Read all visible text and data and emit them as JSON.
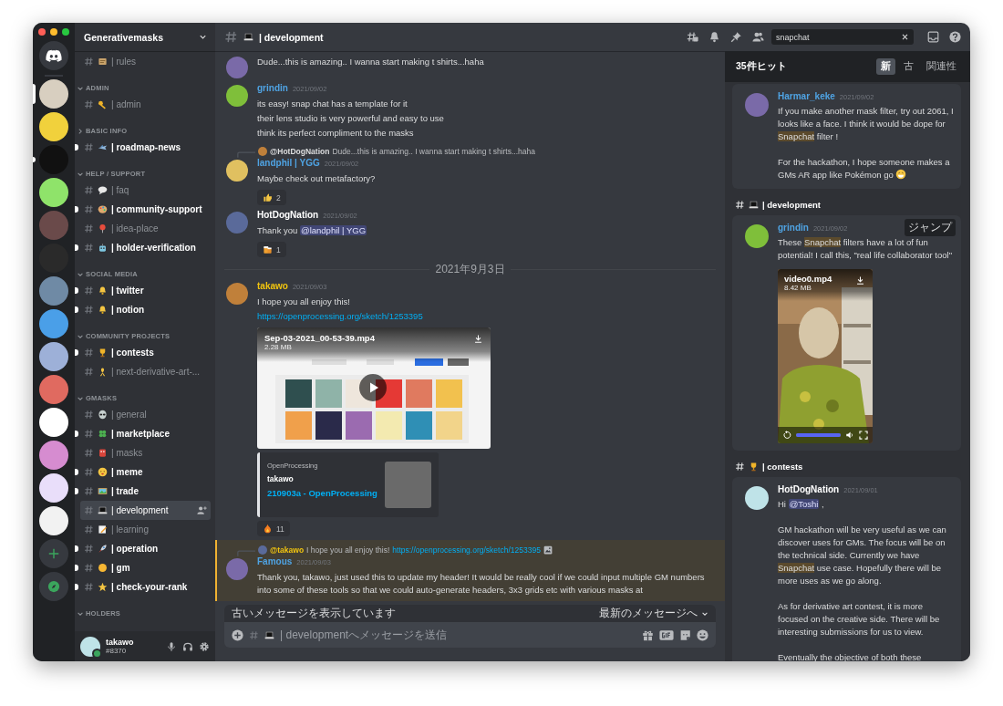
{
  "servers": [
    {
      "selected": true,
      "unread": false
    },
    {
      "selected": false,
      "unread": false
    },
    {
      "selected": false,
      "unread": true
    },
    {
      "selected": false,
      "unread": false
    },
    {
      "selected": false,
      "unread": false
    },
    {
      "selected": false,
      "unread": false
    },
    {
      "selected": false,
      "unread": false
    },
    {
      "selected": false,
      "unread": false
    },
    {
      "selected": false,
      "unread": false
    },
    {
      "selected": false,
      "unread": false
    },
    {
      "selected": false,
      "unread": false
    },
    {
      "selected": false,
      "unread": false
    },
    {
      "selected": false,
      "unread": false
    },
    {
      "selected": false,
      "unread": false
    }
  ],
  "server_name": "Generativemasks",
  "channel_sections": [
    {
      "channels": [
        {
          "name": "| rules",
          "kind": "scroll",
          "unread": false,
          "selected": false
        }
      ]
    },
    {
      "category": "ADMIN",
      "expanded": true,
      "channels": [
        {
          "name": "| admin",
          "kind": "key",
          "unread": false,
          "selected": false
        }
      ]
    },
    {
      "category": "BASIC INFO",
      "expanded": false,
      "channels": [
        {
          "name": "| roadmap-news",
          "kind": "plane",
          "unread": true,
          "selected": false
        }
      ]
    },
    {
      "category": "HELP / SUPPORT",
      "expanded": true,
      "channels": [
        {
          "name": "| faq",
          "kind": "bubble",
          "unread": false,
          "selected": false
        },
        {
          "name": "| community-support",
          "kind": "palette",
          "unread": true,
          "selected": false
        },
        {
          "name": "| idea-place",
          "kind": "pin",
          "unread": false,
          "selected": false
        },
        {
          "name": "| holder-verification",
          "kind": "robot",
          "unread": true,
          "selected": false
        }
      ]
    },
    {
      "category": "SOCIAL MEDIA",
      "expanded": true,
      "channels": [
        {
          "name": "| twitter",
          "kind": "bell",
          "unread": true,
          "selected": false
        },
        {
          "name": "| notion",
          "kind": "bell",
          "unread": true,
          "selected": false
        }
      ]
    },
    {
      "category": "COMMUNITY PROJECTS",
      "expanded": true,
      "channels": [
        {
          "name": "| contests",
          "kind": "trophy",
          "unread": true,
          "selected": false
        },
        {
          "name": "| next-derivative-art-...",
          "kind": "ribbon",
          "unread": false,
          "selected": false
        }
      ]
    },
    {
      "category": "GMASKS",
      "expanded": true,
      "channels": [
        {
          "name": "| general",
          "kind": "alien",
          "unread": false,
          "selected": false
        },
        {
          "name": "| marketplace",
          "kind": "clover",
          "unread": true,
          "selected": false
        },
        {
          "name": "| masks",
          "kind": "mask",
          "unread": false,
          "selected": false
        },
        {
          "name": "| meme",
          "kind": "face",
          "unread": true,
          "selected": false
        },
        {
          "name": "| trade",
          "kind": "picture",
          "unread": true,
          "selected": false
        },
        {
          "name": "| development",
          "kind": "laptop",
          "unread": false,
          "selected": true
        },
        {
          "name": "| learning",
          "kind": "pencil",
          "unread": false,
          "selected": false
        },
        {
          "name": "| operation",
          "kind": "rocket",
          "unread": true,
          "selected": false
        },
        {
          "name": "| gm",
          "kind": "sun",
          "unread": true,
          "selected": false
        },
        {
          "name": "| check-your-rank",
          "kind": "star",
          "unread": true,
          "selected": false
        }
      ]
    },
    {
      "category": "HOLDERS",
      "expanded": true
    }
  ],
  "user": {
    "name": "takawo",
    "tag": "#8370"
  },
  "channel_header": {
    "name": "| development",
    "kind": "laptop"
  },
  "search": {
    "value": "snapchat"
  },
  "messages": [
    {
      "kind": "message",
      "lines": [
        "Dude...this is amazing.. I wanna start making t shirts...haha"
      ]
    },
    {
      "kind": "message",
      "author": {
        "name": "grindin",
        "color": "#4fa3e3"
      },
      "time": "2021/09/02",
      "lines": [
        "its easy! snap chat has a template for it",
        "their lens studio is very powerful and easy to use",
        "think its perfect compliment to the masks"
      ]
    },
    {
      "kind": "message",
      "reply": {
        "author": "@HotDogNation",
        "text": "Dude...this is amazing.. I wanna start making t shirts...haha"
      },
      "author": {
        "name": "landphil | YGG",
        "color": "#4fa3e3"
      },
      "time": "2021/09/02",
      "lines": [
        "Maybe check out metafactory?"
      ],
      "reactions": [
        {
          "kind": "thumbs",
          "count": "2"
        }
      ]
    },
    {
      "kind": "message",
      "author": {
        "name": "HotDogNation",
        "color": "#ffffff"
      },
      "time": "2021/09/02",
      "lines": [
        [
          "Thank you ",
          {
            "text": "@landphil | YGG",
            "kind": "mention"
          }
        ]
      ],
      "reactions": [
        {
          "kind": "beer",
          "count": "1"
        }
      ]
    },
    {
      "kind": "divider",
      "text": "2021年9月3日"
    },
    {
      "kind": "message",
      "author": {
        "name": "takawo",
        "color": "#f1c40f"
      },
      "time": "2021/09/03",
      "lines": [
        "I hope you all enjoy this!",
        {
          "text": "https://openprocessing.org/sketch/1253395",
          "kind": "link"
        }
      ],
      "video": {
        "filename": "Sep-03-2021_00-53-39.mp4",
        "size": "2.28 MB"
      },
      "embed": {
        "provider": "OpenProcessing",
        "author": "takawo",
        "title": "210903a - OpenProcessing"
      },
      "reactions": [
        {
          "kind": "fire",
          "count": "11"
        }
      ]
    },
    {
      "kind": "message",
      "highlighted": true,
      "reply": {
        "author": "@takawo",
        "color": "#f1c40f",
        "text": "I hope you all enjoy this!",
        "link": "https://openprocessing.org/sketch/1253395",
        "image": true
      },
      "author": {
        "name": "Famous",
        "color": "#4fa3e3"
      },
      "time": "2021/09/03",
      "lines": [
        "Thank you, takawo, just used this to update my header! It would be really cool if we could input multiple GM numbers into some of these tools so that we could auto-generate headers, 3x3 grids etc with various masks at"
      ]
    }
  ],
  "notice_bar": {
    "text": "古いメッセージを表示しています",
    "jump_label": "最新のメッセージへ"
  },
  "composer": {
    "kind": "laptop",
    "placeholder": "| developmentへメッセージを送信"
  },
  "search_results": {
    "count": "35件ヒット",
    "sort_tabs": [
      {
        "label": "新",
        "selected": true
      },
      {
        "label": "古",
        "selected": false
      },
      {
        "label": "関連性",
        "selected": false
      }
    ],
    "groups": [
      {
        "results": [
          {
            "author": {
              "name": "Harmar_keke",
              "color": "#4fa3e3"
            },
            "time": "2021/09/02",
            "paragraphs": [
              [
                "If you make another mask filter, try out 2061, I looks like a face. I think it would be dope for ",
                {
                  "text": "Snapchat",
                  "kind": "highlight"
                },
                " filter !"
              ],
              [
                "For the hackathon, I hope someone makes a GMs AR app like Pokémon go ",
                {
                  "kind": "grin"
                }
              ]
            ]
          }
        ]
      },
      {
        "channel": {
          "name": "| development",
          "kind": "laptop"
        },
        "results": [
          {
            "author": {
              "name": "grindin",
              "color": "#4fa3e3"
            },
            "time": "2021/09/02",
            "jump_label": "ジャンプ",
            "paragraphs": [
              [
                "These ",
                {
                  "text": "Snapchat",
                  "kind": "highlight"
                },
                " filters have a lot of fun potential! I call this, \"real life collaborator tool\""
              ]
            ],
            "video": {
              "filename": "video0.mp4",
              "size": "8.42 MB",
              "level": 1
            }
          }
        ]
      },
      {
        "channel": {
          "name": "| contests",
          "kind": "trophy"
        },
        "results": [
          {
            "author": {
              "name": "HotDogNation",
              "color": "#ffffff"
            },
            "time": "2021/09/01",
            "paragraphs": [
              [
                "Hi ",
                {
                  "text": "@Toshi",
                  "kind": "mention"
                },
                " ,"
              ],
              [
                "GM hackathon will be very useful as we can discover uses for GMs. The focus will be on the technical side. Currently we have ",
                {
                  "text": "Snapchat",
                  "kind": "highlight"
                },
                " use case. Hopefully there will be more uses as we go along."
              ],
              [
                "As for derivative art contest, it is more focused on the creative side. There will be interesting submissions for us to view."
              ],
              [
                "Eventually the objective of both these"
              ]
            ]
          }
        ]
      }
    ]
  }
}
